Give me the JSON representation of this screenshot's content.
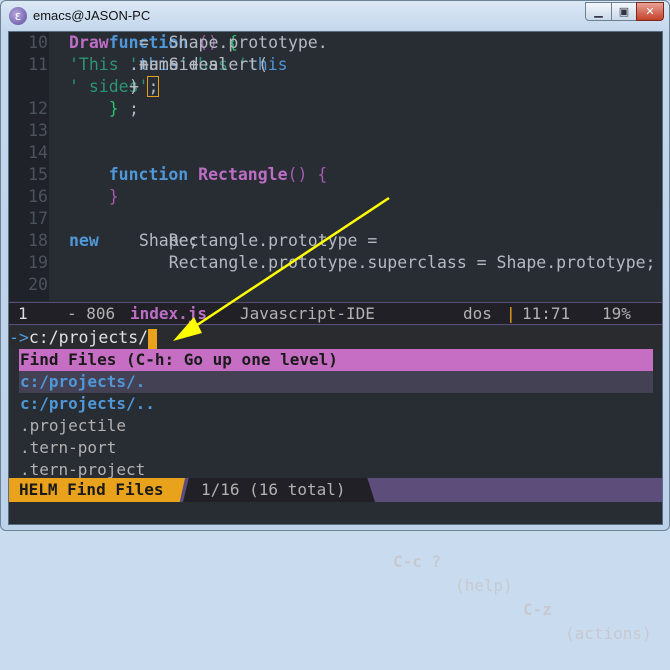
{
  "window": {
    "title": "emacs@JASON-PC",
    "controls": [
      "minimize",
      "maximize",
      "close"
    ]
  },
  "editor": {
    "lines": [
      {
        "n": "10",
        "segs": [
          [
            "code",
            "    Shape.prototype."
          ],
          [
            "fn",
            "Draw"
          ],
          [
            "code",
            " = "
          ],
          [
            "kw",
            "function"
          ],
          [
            "p",
            " () "
          ],
          [
            "g",
            "{"
          ]
        ]
      },
      {
        "n": "11",
        "segs": [
          [
            "code",
            "        alert("
          ],
          [
            "str",
            "'This '"
          ],
          [
            "code",
            " + "
          ],
          [
            "this",
            "this"
          ],
          [
            "code",
            ".name + "
          ],
          [
            "str",
            "' has '"
          ],
          [
            "code",
            " + "
          ],
          [
            "this",
            "this"
          ],
          [
            "code",
            ".numSides"
          ]
        ]
      },
      {
        "n": "",
        "segs": [
          [
            "code",
            "+ "
          ],
          [
            "str",
            "' sides'"
          ],
          [
            "code",
            ")"
          ],
          [
            "cur",
            ";"
          ]
        ]
      },
      {
        "n": "12",
        "segs": [
          [
            "g",
            "    }"
          ],
          [
            "code",
            ";"
          ]
        ]
      },
      {
        "n": "13",
        "segs": []
      },
      {
        "n": "14",
        "segs": []
      },
      {
        "n": "15",
        "segs": [
          [
            "kw",
            "    function "
          ],
          [
            "fn",
            "Rectangle"
          ],
          [
            "p",
            "() {"
          ]
        ]
      },
      {
        "n": "16",
        "segs": [
          [
            "p",
            "    }"
          ]
        ]
      },
      {
        "n": "17",
        "segs": []
      },
      {
        "n": "18",
        "segs": [
          [
            "code",
            "    Rectangle.prototype = "
          ],
          [
            "kw",
            "new"
          ],
          [
            "code",
            " Shape;"
          ]
        ]
      },
      {
        "n": "19",
        "segs": [
          [
            "code",
            "    Rectangle.prototype.superclass = Shape.prototype;"
          ]
        ]
      },
      {
        "n": "20",
        "segs": []
      }
    ]
  },
  "modeline": {
    "window_number": "1",
    "state": "- 806",
    "buffer": "index.js",
    "mode": "Javascript-IDE",
    "eol": "dos",
    "sep": "|",
    "position": "11:71",
    "percent": "19%"
  },
  "minibuffer": {
    "prompt": "->",
    "input": "c:/projects/"
  },
  "helm": {
    "header": "Find Files (C-h: Go up one level)",
    "items": [
      {
        "label": "c:/projects/.",
        "type": "dir",
        "selected": true
      },
      {
        "label": "c:/projects/..",
        "type": "dir",
        "selected": false
      },
      {
        "label": ".projectile",
        "type": "file",
        "selected": false
      },
      {
        "label": ".tern-port",
        "type": "file",
        "selected": false
      },
      {
        "label": ".tern-project",
        "type": "file",
        "selected": false
      }
    ],
    "mode_name": "HELM Find Files",
    "count": "1/16 (16 total)",
    "help_key": "C-c ?",
    "help_label": "(help)",
    "actions_key": "C-z",
    "actions_label": "(actions)"
  },
  "colors": {
    "accent": "#e8a21c",
    "helm_header": "#c56ec3",
    "selection": "#444155",
    "arrow": "#ffff00"
  }
}
